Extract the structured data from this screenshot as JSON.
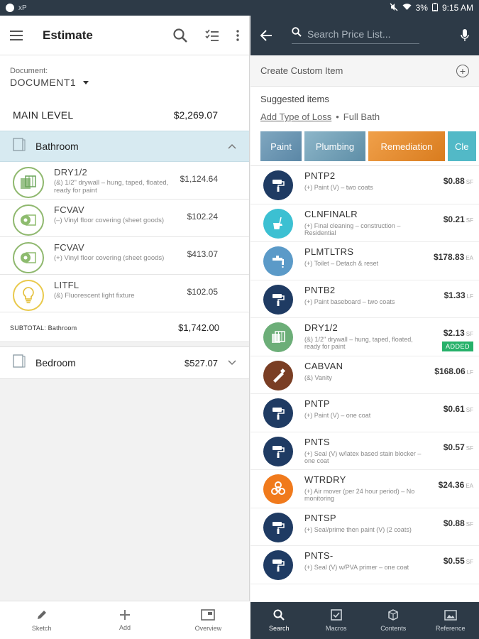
{
  "status_bar": {
    "left_text": "xP",
    "battery": "3%",
    "time": "9:15 AM"
  },
  "left": {
    "title": "Estimate",
    "document_label": "Document:",
    "document_value": "DOCUMENT1",
    "level_name": "MAIN LEVEL",
    "level_total": "$2,269.07",
    "rooms": [
      {
        "name": "Bathroom",
        "items": [
          {
            "code": "DRY1/2",
            "desc": "(&) 1/2\" drywall – hung, taped, floated, ready for paint",
            "amount": "$1,124.64",
            "icon": "drywall-icon"
          },
          {
            "code": "FCVAV",
            "desc": "(–) Vinyl floor covering (sheet goods)",
            "amount": "$102.24",
            "icon": "floor-roll-icon"
          },
          {
            "code": "FCVAV",
            "desc": "(+) Vinyl floor covering (sheet goods)",
            "amount": "$413.07",
            "icon": "floor-roll-icon"
          },
          {
            "code": "LITFL",
            "desc": "(&) Fluorescent light fixture",
            "amount": "$102.05",
            "icon": "lightbulb-icon"
          }
        ],
        "subtotal_label": "SUBTOTAL: Bathroom",
        "subtotal": "$1,742.00"
      },
      {
        "name": "Bedroom",
        "total": "$527.07"
      }
    ],
    "bottom_nav": [
      {
        "label": "Sketch",
        "icon": "pencil-icon"
      },
      {
        "label": "Add",
        "icon": "plus-icon"
      },
      {
        "label": "Overview",
        "icon": "overview-icon"
      }
    ]
  },
  "right": {
    "search_placeholder": "Search Price List...",
    "create_custom": "Create Custom Item",
    "suggested_header": "Suggested items",
    "add_type_of_loss": "Add Type of Loss",
    "loss_value": "Full Bath",
    "categories": [
      "Paint",
      "Plumbing",
      "Remediation",
      "Cle"
    ],
    "items": [
      {
        "code": "PNTP2",
        "desc": "(+) Paint (V) – two coats",
        "price": "$0.88",
        "unit": "SF",
        "icon": "paint-roller-icon",
        "color": "#1f3b63",
        "added": ""
      },
      {
        "code": "CLNFINALR",
        "desc": "(+) Final cleaning – construction – Residential",
        "price": "$0.21",
        "unit": "SF",
        "icon": "cleaning-bucket-icon",
        "color": "#3cc0d2",
        "added": ""
      },
      {
        "code": "PLMTLTRS",
        "desc": "(+) Toilet – Detach & reset",
        "price": "$178.83",
        "unit": "EA",
        "icon": "faucet-icon",
        "color": "#5b9ac8",
        "added": ""
      },
      {
        "code": "PNTB2",
        "desc": "(+) Paint baseboard – two coats",
        "price": "$1.33",
        "unit": "LF",
        "icon": "paint-roller-icon",
        "color": "#1f3b63",
        "added": ""
      },
      {
        "code": "DRY1/2",
        "desc": "(&) 1/2\" drywall – hung, taped, floated, ready for paint",
        "price": "$2.13",
        "unit": "SF",
        "icon": "drywall-icon",
        "color": "#6cae78",
        "added": "ADDED"
      },
      {
        "code": "CABVAN",
        "desc": "(&) Vanity",
        "price": "$168.06",
        "unit": "LF",
        "icon": "saw-icon",
        "color": "#7a3e24",
        "added": ""
      },
      {
        "code": "PNTP",
        "desc": "(+) Paint (V) – one coat",
        "price": "$0.61",
        "unit": "SF",
        "icon": "paint-roller-icon",
        "color": "#1f3b63",
        "added": ""
      },
      {
        "code": "PNTS",
        "desc": "(+) Seal (V) w/latex based stain blocker – one coat",
        "price": "$0.57",
        "unit": "SF",
        "icon": "paint-roller-icon",
        "color": "#1f3b63",
        "added": ""
      },
      {
        "code": "WTRDRY",
        "desc": "(+) Air mover (per 24 hour period) – No monitoring",
        "price": "$24.36",
        "unit": "EA",
        "icon": "biohazard-icon",
        "color": "#f07a1c",
        "added": ""
      },
      {
        "code": "PNTSP",
        "desc": "(+) Seal/prime then paint (V) (2 coats)",
        "price": "$0.88",
        "unit": "SF",
        "icon": "paint-roller-icon",
        "color": "#1f3b63",
        "added": ""
      },
      {
        "code": "PNTS-",
        "desc": "(+) Seal (V) w/PVA primer – one coat",
        "price": "$0.55",
        "unit": "SF",
        "icon": "paint-roller-icon",
        "color": "#1f3b63",
        "added": ""
      }
    ],
    "bottom_nav": [
      {
        "label": "Search",
        "icon": "search-icon",
        "active": true
      },
      {
        "label": "Macros",
        "icon": "checkbox-icon",
        "active": false
      },
      {
        "label": "Contents",
        "icon": "box-icon",
        "active": false
      },
      {
        "label": "Reference",
        "icon": "image-icon",
        "active": false
      }
    ]
  }
}
